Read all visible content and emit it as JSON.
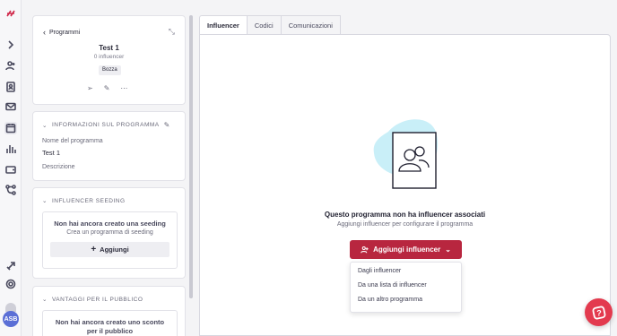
{
  "rail": {
    "icons": [
      "logo-icon",
      "chevron-right-icon",
      "users-icon",
      "contacts-icon",
      "mail-icon",
      "calendar-icon",
      "analytics-icon",
      "wallet-icon",
      "workflow-icon",
      "rocket-icon",
      "settings-icon"
    ],
    "avatar_initials": "ASB"
  },
  "program": {
    "back_label": "Programmi",
    "name": "Test 1",
    "influencer_count": "0 influencer",
    "status_badge": "Bozza"
  },
  "info_section": {
    "title": "INFORMAZIONI SUL PROGRAMMA",
    "name_label": "Nome del programma",
    "name_value": "Test 1",
    "description_label": "Descrizione"
  },
  "seeding_section": {
    "title": "INFLUENCER SEEDING",
    "empty_title": "Non hai ancora creato una seeding",
    "empty_subtitle": "Crea un programma di seeding",
    "add_label": "Aggiungi"
  },
  "benefits_section": {
    "title": "VANTAGGI PER IL PUBBLICO",
    "empty_title": "Non hai ancora creato uno sconto per il pubblico"
  },
  "tabs": [
    {
      "label": "Influencer"
    },
    {
      "label": "Codici"
    },
    {
      "label": "Comunicazioni"
    }
  ],
  "empty_state": {
    "title": "Questo programma non ha influencer associati",
    "subtitle": "Aggiungi influencer per configurare il programma",
    "primary_label": "Aggiungi influencer"
  },
  "dropdown": {
    "items": [
      "Dagli influencer",
      "Da una lista di influencer",
      "Da un altro programma"
    ]
  },
  "colors": {
    "accent": "#b8263f",
    "help": "#e33a4e",
    "illustration_blob": "#c9eff8"
  }
}
